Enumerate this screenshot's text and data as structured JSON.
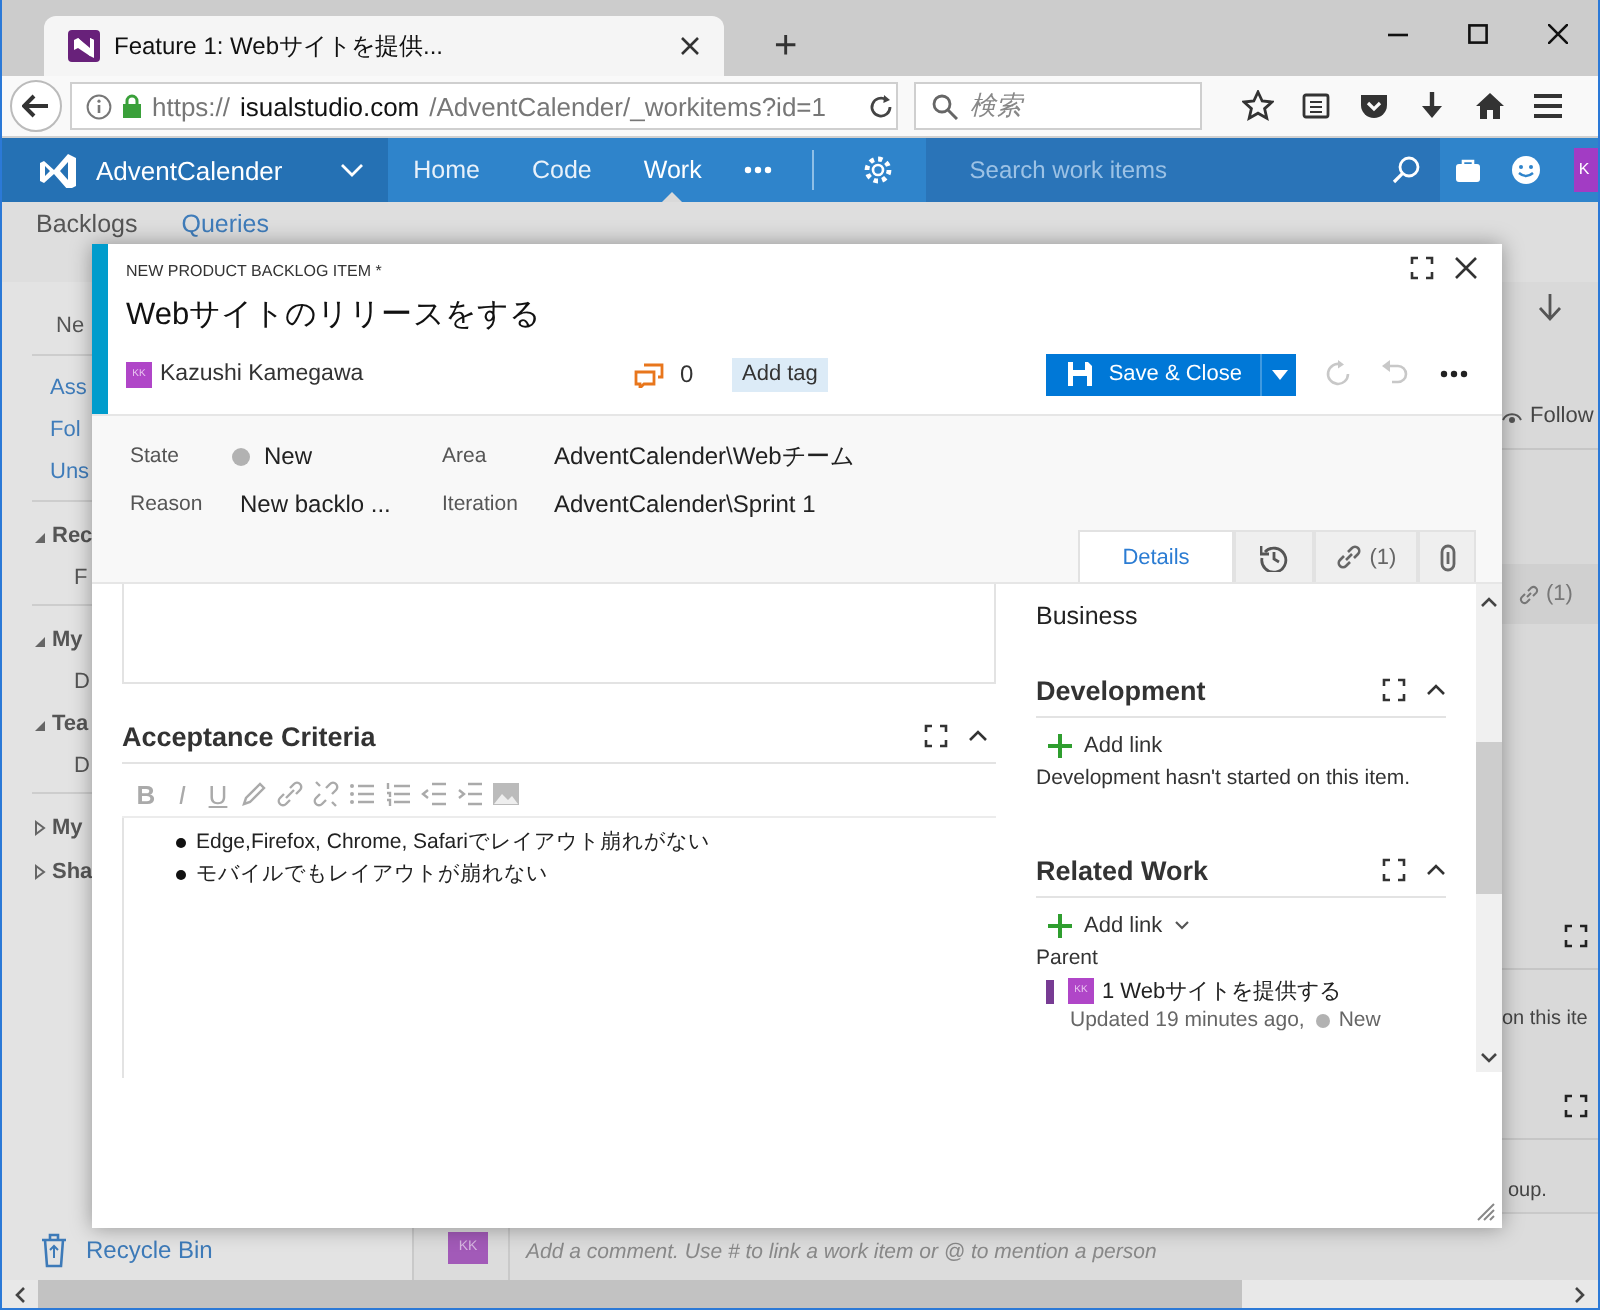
{
  "browser": {
    "tab_title": "Feature 1: Webサイトを提供...",
    "new_tab": "+",
    "url": {
      "scheme": "https://",
      "host": "isualstudio.com",
      "path": "/AdventCalender/_workitems?id=1"
    },
    "search_placeholder": "検索"
  },
  "nav": {
    "project": "AdventCalender",
    "items": [
      {
        "label": "Home",
        "selected": false
      },
      {
        "label": "Code",
        "selected": false
      },
      {
        "label": "Work",
        "selected": true
      }
    ],
    "search_placeholder": "Search work items",
    "avatar": "K"
  },
  "page": {
    "tabs": [
      {
        "label": "Backlogs",
        "selected": true
      },
      {
        "label": "Queries",
        "selected": false
      }
    ],
    "sidebar": [
      {
        "kind": "item",
        "label": "Ne"
      },
      {
        "kind": "rule"
      },
      {
        "kind": "link",
        "label": "Ass"
      },
      {
        "kind": "link",
        "label": "Fol"
      },
      {
        "kind": "link",
        "label": "Uns"
      },
      {
        "kind": "rule"
      },
      {
        "kind": "group",
        "label": "Rec",
        "expanded": true,
        "children": [
          {
            "label": "F"
          }
        ]
      },
      {
        "kind": "rule"
      },
      {
        "kind": "group",
        "label": "My",
        "expanded": true,
        "children": [
          {
            "label": "D"
          }
        ]
      },
      {
        "kind": "group",
        "label": "Tea",
        "expanded": true,
        "children": [
          {
            "label": "D"
          }
        ]
      },
      {
        "kind": "rule"
      },
      {
        "kind": "group",
        "label": "My",
        "expanded": false
      },
      {
        "kind": "group",
        "label": "Sha",
        "expanded": false
      }
    ],
    "recycle_bin": "Recycle Bin",
    "follow": "Follow",
    "links_count": "(1)",
    "fragment_1": "on this ite",
    "fragment_2": "oup.",
    "comment_avatar": "KK",
    "comment_placeholder": "Add a comment. Use # to link a work item or @ to mention a person"
  },
  "dialog": {
    "type_label": "NEW PRODUCT BACKLOG ITEM *",
    "title": "Webサイトのリリースをする",
    "assignee": {
      "initials": "KK",
      "name": "Kazushi Kamegawa"
    },
    "comment_count": "0",
    "add_tag": "Add tag",
    "save": "Save & Close",
    "fields": [
      {
        "kind": "state",
        "label": "State",
        "value": "New"
      },
      {
        "kind": "text",
        "label": "Area",
        "value": "AdventCalender\\Webチーム"
      },
      {
        "kind": "text",
        "label": "Reason",
        "value": "New backlo ..."
      },
      {
        "kind": "text",
        "label": "Iteration",
        "value": "AdventCalender\\Sprint 1"
      }
    ],
    "tabs": [
      {
        "kind": "text",
        "label": "Details",
        "selected": true
      },
      {
        "kind": "history",
        "selected": false
      },
      {
        "kind": "links",
        "label": "(1)",
        "selected": false
      },
      {
        "kind": "attachments",
        "selected": false
      }
    ],
    "acceptance": {
      "heading": "Acceptance Criteria",
      "format_buttons": [
        "B",
        "I",
        "U"
      ],
      "items": [
        "Edge,Firefox, Chrome, Safariでレイアウト崩れがない",
        "モバイルでもレイアウトが崩れない"
      ]
    },
    "value_area": "Business",
    "development": {
      "heading": "Development",
      "add_link": "Add link",
      "message": "Development hasn't started on this item."
    },
    "related": {
      "heading": "Related Work",
      "add_link": "Add link",
      "parent_label": "Parent",
      "parent": {
        "initials": "KK",
        "title": "1 Webサイトを提供する",
        "updated": "Updated 19 minutes ago,",
        "state": "New"
      }
    }
  }
}
